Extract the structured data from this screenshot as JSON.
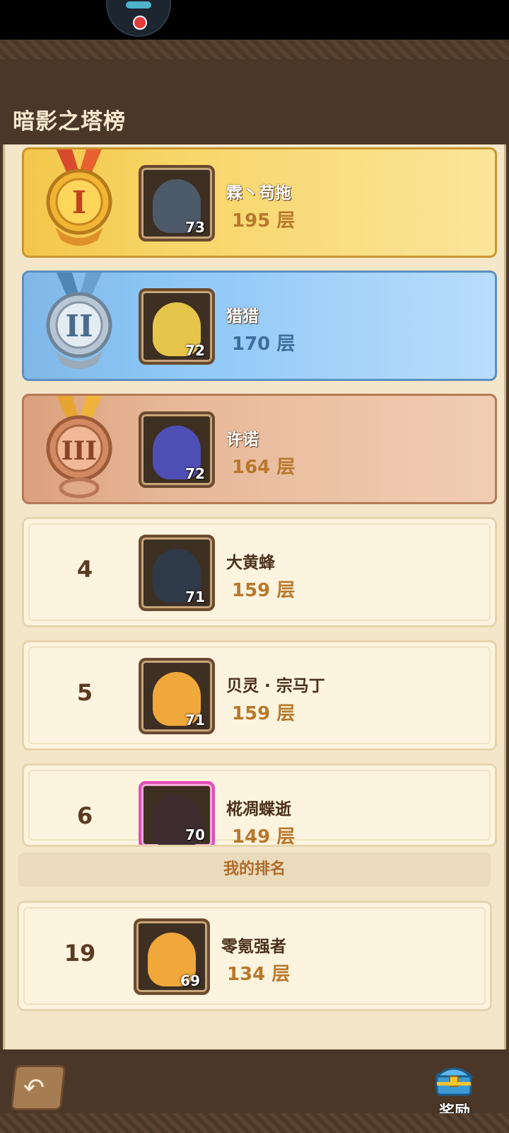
{
  "page": {
    "title": "暗影之塔榜"
  },
  "ranking": [
    {
      "rank": "1",
      "name": "霖丶苟拖",
      "level": "73",
      "floors": "195 层",
      "tier": "gold"
    },
    {
      "rank": "2",
      "name": "猎猎",
      "level": "72",
      "floors": "170 层",
      "tier": "silver"
    },
    {
      "rank": "3",
      "name": "许诺",
      "level": "72",
      "floors": "164 层",
      "tier": "bronze"
    },
    {
      "rank": "4",
      "name": "大黄蜂",
      "level": "71",
      "floors": "159 层",
      "tier": "plain"
    },
    {
      "rank": "5",
      "name": "贝灵 · 宗马丁",
      "level": "71",
      "floors": "159 层",
      "tier": "plain"
    },
    {
      "rank": "6",
      "name": "椛凋蝶逝",
      "level": "70",
      "floors": "149 层",
      "tier": "plain"
    }
  ],
  "my_rank": {
    "label": "我的排名",
    "rank": "19",
    "name": "零氪强者",
    "level": "69",
    "floors": "134 层"
  },
  "bottom": {
    "back_icon": "back-arrow-icon",
    "reward_label": "奖励"
  },
  "colors": {
    "gold": "#f6cf55",
    "silver": "#8dc7f7",
    "bronze": "#e7b797",
    "text_brown": "#b8782c"
  }
}
